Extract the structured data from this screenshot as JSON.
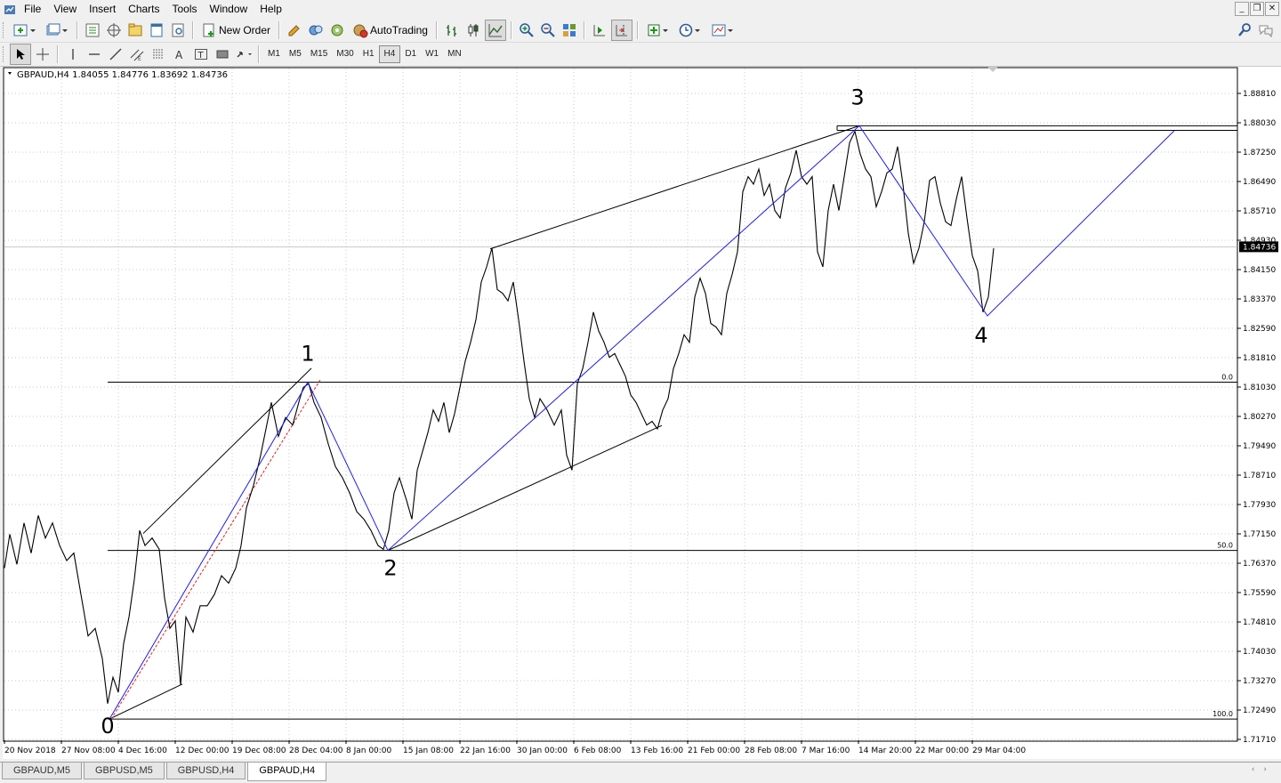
{
  "menu": [
    "File",
    "View",
    "Insert",
    "Charts",
    "Tools",
    "Window",
    "Help"
  ],
  "toolbar": {
    "new_order": "New Order",
    "autotrading": "AutoTrading"
  },
  "timeframes": [
    "M1",
    "M5",
    "M15",
    "M30",
    "H1",
    "H4",
    "D1",
    "W1",
    "MN"
  ],
  "active_timeframe": "H4",
  "chart_info": "GBPAUD,H4  1.84055 1.84776 1.83692 1.84736",
  "current_price": "1.84736",
  "price_levels": [
    "1.88810",
    "1.88030",
    "1.87250",
    "1.86490",
    "1.85710",
    "1.84930",
    "1.84150",
    "1.83370",
    "1.82590",
    "1.81810",
    "1.81030",
    "1.80270",
    "1.79490",
    "1.78710",
    "1.77930",
    "1.77150",
    "1.76370",
    "1.75590",
    "1.74810",
    "1.74030",
    "1.73270",
    "1.72490",
    "1.71710"
  ],
  "time_labels": [
    "20 Nov 2018",
    "27 Nov 08:00",
    "4 Dec 16:00",
    "12 Dec 00:00",
    "19 Dec 08:00",
    "28 Dec 04:00",
    "8 Jan 00:00",
    "15 Jan 08:00",
    "22 Jan 16:00",
    "30 Jan 00:00",
    "6 Feb 08:00",
    "13 Feb 16:00",
    "21 Feb 00:00",
    "28 Feb 08:00",
    "7 Mar 16:00",
    "14 Mar 20:00",
    "22 Mar 00:00",
    "29 Mar 04:00"
  ],
  "fib_levels": [
    "0.0",
    "50.0",
    "100.0"
  ],
  "wave_labels": [
    "0",
    "1",
    "2",
    "3",
    "4"
  ],
  "tabs": [
    "GBPAUD,M5",
    "GBPUSD,M5",
    "GBPUSD,H4",
    "GBPAUD,H4"
  ],
  "active_tab": "GBPAUD,H4",
  "chart_data": {
    "type": "line",
    "symbol": "GBPAUD",
    "timeframe": "H4",
    "ohlc_last": {
      "open": 1.84055,
      "high": 1.84776,
      "low": 1.83692,
      "close": 1.84736
    },
    "ylim": [
      1.7171,
      1.8881
    ],
    "x": [
      "20 Nov 2018",
      "27 Nov 08:00",
      "4 Dec 16:00",
      "12 Dec 00:00",
      "19 Dec 08:00",
      "28 Dec 04:00",
      "8 Jan 00:00",
      "15 Jan 08:00",
      "22 Jan 16:00",
      "30 Jan 00:00",
      "6 Feb 08:00",
      "13 Feb 16:00",
      "21 Feb 00:00",
      "28 Feb 08:00",
      "7 Mar 16:00",
      "14 Mar 20:00",
      "22 Mar 00:00",
      "29 Mar 04:00"
    ],
    "series": [
      {
        "values": [
          [
            0,
            1.762
          ],
          [
            6,
            1.771
          ],
          [
            14,
            1.763
          ],
          [
            22,
            1.774
          ],
          [
            30,
            1.766
          ],
          [
            38,
            1.776
          ],
          [
            46,
            1.77
          ],
          [
            54,
            1.774
          ],
          [
            62,
            1.768
          ],
          [
            70,
            1.764
          ],
          [
            78,
            1.766
          ],
          [
            86,
            1.755
          ],
          [
            94,
            1.744
          ],
          [
            102,
            1.746
          ],
          [
            110,
            1.738
          ],
          [
            116,
            1.726
          ],
          [
            122,
            1.733
          ],
          [
            128,
            1.729
          ],
          [
            134,
            1.742
          ],
          [
            140,
            1.749
          ],
          [
            146,
            1.759
          ],
          [
            152,
            1.772
          ],
          [
            158,
            1.768
          ],
          [
            166,
            1.77
          ],
          [
            174,
            1.767
          ],
          [
            180,
            1.754
          ],
          [
            186,
            1.746
          ],
          [
            192,
            1.748
          ],
          [
            198,
            1.731
          ],
          [
            204,
            1.749
          ],
          [
            212,
            1.745
          ],
          [
            220,
            1.752
          ],
          [
            228,
            1.752
          ],
          [
            236,
            1.755
          ],
          [
            244,
            1.76
          ],
          [
            252,
            1.758
          ],
          [
            260,
            1.762
          ],
          [
            266,
            1.768
          ],
          [
            272,
            1.778
          ],
          [
            280,
            1.784
          ],
          [
            288,
            1.792
          ],
          [
            294,
            1.799
          ],
          [
            300,
            1.806
          ],
          [
            308,
            1.797
          ],
          [
            316,
            1.802
          ],
          [
            324,
            1.8
          ],
          [
            332,
            1.807
          ],
          [
            336,
            1.81
          ],
          [
            342,
            1.811
          ],
          [
            348,
            1.806
          ],
          [
            356,
            1.802
          ],
          [
            364,
            1.795
          ],
          [
            372,
            1.789
          ],
          [
            380,
            1.786
          ],
          [
            388,
            1.782
          ],
          [
            396,
            1.777
          ],
          [
            404,
            1.775
          ],
          [
            412,
            1.772
          ],
          [
            420,
            1.768
          ],
          [
            426,
            1.767
          ],
          [
            432,
            1.772
          ],
          [
            438,
            1.782
          ],
          [
            444,
            1.786
          ],
          [
            452,
            1.78
          ],
          [
            458,
            1.775
          ],
          [
            464,
            1.788
          ],
          [
            470,
            1.793
          ],
          [
            476,
            1.798
          ],
          [
            482,
            1.804
          ],
          [
            488,
            1.801
          ],
          [
            494,
            1.806
          ],
          [
            500,
            1.798
          ],
          [
            506,
            1.803
          ],
          [
            512,
            1.81
          ],
          [
            518,
            1.817
          ],
          [
            524,
            1.822
          ],
          [
            530,
            1.828
          ],
          [
            536,
            1.838
          ],
          [
            542,
            1.842
          ],
          [
            548,
            1.847
          ],
          [
            554,
            1.836
          ],
          [
            560,
            1.835
          ],
          [
            566,
            1.833
          ],
          [
            572,
            1.838
          ],
          [
            578,
            1.828
          ],
          [
            584,
            1.817
          ],
          [
            590,
            1.807
          ],
          [
            596,
            1.802
          ],
          [
            602,
            1.807
          ],
          [
            610,
            1.804
          ],
          [
            618,
            1.8
          ],
          [
            626,
            1.804
          ],
          [
            632,
            1.792
          ],
          [
            638,
            1.788
          ],
          [
            644,
            1.811
          ],
          [
            650,
            1.815
          ],
          [
            656,
            1.822
          ],
          [
            662,
            1.83
          ],
          [
            668,
            1.825
          ],
          [
            674,
            1.822
          ],
          [
            680,
            1.818
          ],
          [
            686,
            1.819
          ],
          [
            692,
            1.816
          ],
          [
            698,
            1.813
          ],
          [
            704,
            1.808
          ],
          [
            710,
            1.806
          ],
          [
            716,
            1.803
          ],
          [
            722,
            1.8
          ],
          [
            728,
            1.801
          ],
          [
            734,
            1.799
          ],
          [
            740,
            1.804
          ],
          [
            746,
            1.807
          ],
          [
            752,
            1.815
          ],
          [
            758,
            1.819
          ],
          [
            764,
            1.824
          ],
          [
            770,
            1.822
          ],
          [
            776,
            1.834
          ],
          [
            782,
            1.839
          ],
          [
            788,
            1.835
          ],
          [
            794,
            1.827
          ],
          [
            800,
            1.826
          ],
          [
            806,
            1.824
          ],
          [
            812,
            1.835
          ],
          [
            818,
            1.84
          ],
          [
            824,
            1.846
          ],
          [
            830,
            1.862
          ],
          [
            836,
            1.866
          ],
          [
            842,
            1.864
          ],
          [
            848,
            1.868
          ],
          [
            854,
            1.861
          ],
          [
            860,
            1.864
          ],
          [
            866,
            1.857
          ],
          [
            872,
            1.855
          ],
          [
            878,
            1.863
          ],
          [
            884,
            1.867
          ],
          [
            890,
            1.873
          ],
          [
            896,
            1.866
          ],
          [
            902,
            1.864
          ],
          [
            908,
            1.866
          ],
          [
            914,
            1.846
          ],
          [
            920,
            1.842
          ],
          [
            926,
            1.857
          ],
          [
            932,
            1.864
          ],
          [
            938,
            1.857
          ],
          [
            944,
            1.866
          ],
          [
            950,
            1.875
          ],
          [
            956,
            1.878
          ],
          [
            962,
            1.872
          ],
          [
            968,
            1.868
          ],
          [
            974,
            1.866
          ],
          [
            980,
            1.858
          ],
          [
            986,
            1.862
          ],
          [
            992,
            1.867
          ],
          [
            998,
            1.868
          ],
          [
            1004,
            1.874
          ],
          [
            1010,
            1.864
          ],
          [
            1016,
            1.851
          ],
          [
            1022,
            1.843
          ],
          [
            1028,
            1.847
          ],
          [
            1034,
            1.854
          ],
          [
            1040,
            1.865
          ],
          [
            1046,
            1.866
          ],
          [
            1052,
            1.859
          ],
          [
            1058,
            1.854
          ],
          [
            1064,
            1.853
          ],
          [
            1070,
            1.86
          ],
          [
            1076,
            1.866
          ],
          [
            1082,
            1.855
          ],
          [
            1088,
            1.845
          ],
          [
            1094,
            1.841
          ],
          [
            1100,
            1.83
          ],
          [
            1106,
            1.834
          ],
          [
            1112,
            1.847
          ]
        ]
      }
    ],
    "horizontal_lines": [
      {
        "label": "0.0",
        "price": 1.8114
      },
      {
        "label": "50.0",
        "price": 1.7667
      },
      {
        "label": "100.0",
        "price": 1.7219
      },
      {
        "price": 1.8795
      },
      {
        "price": 1.8783
      }
    ],
    "wave_points": [
      {
        "label": "0",
        "x": 118,
        "price": 1.7219
      },
      {
        "label": "1",
        "x": 341,
        "price": 1.8114
      },
      {
        "label": "2",
        "x": 431,
        "price": 1.7667
      },
      {
        "label": "3",
        "x": 961,
        "price": 1.8795
      },
      {
        "label": "4",
        "x": 1105,
        "price": 1.829
      },
      {
        "x": 1315,
        "price": 1.8782
      }
    ],
    "trendlines": [
      {
        "from": [
          156,
          1.7712
        ],
        "to": [
          345,
          1.8151
        ]
      },
      {
        "from": [
          118,
          1.7219
        ],
        "to": [
          200,
          1.7312
        ]
      },
      {
        "from": [
          431,
          1.7667
        ],
        "to": [
          739,
          1.7999
        ]
      },
      {
        "from": [
          546,
          1.8468
        ],
        "to": [
          961,
          1.8795
        ]
      }
    ],
    "dashed_lines": [
      {
        "from": [
          120,
          1.7219
        ],
        "to": [
          355,
          1.812
        ]
      }
    ]
  }
}
